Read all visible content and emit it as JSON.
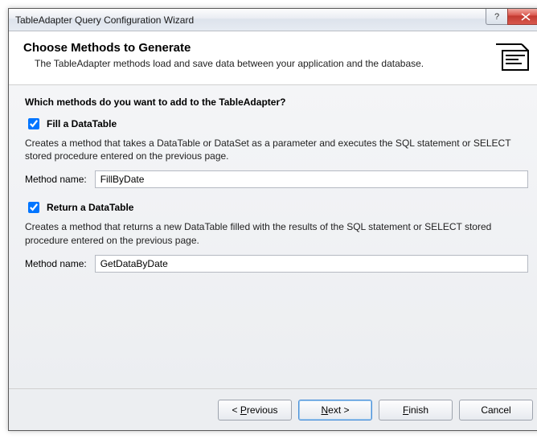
{
  "window": {
    "title": "TableAdapter Query Configuration Wizard"
  },
  "header": {
    "title": "Choose Methods to Generate",
    "subtitle": "The TableAdapter methods load and save data between your application and the database."
  },
  "body": {
    "prompt": "Which methods do you want to add to the TableAdapter?",
    "fill": {
      "checked": true,
      "label": "Fill a DataTable",
      "desc": "Creates a method that takes a DataTable or DataSet as a parameter and executes the SQL statement or SELECT stored procedure entered on the previous page.",
      "method_label": "Method name:",
      "method_value": "FillByDate"
    },
    "ret": {
      "checked": true,
      "label": "Return a DataTable",
      "desc": "Creates a method that returns a new DataTable filled with the results of the SQL statement or SELECT stored procedure entered on the previous page.",
      "method_label": "Method name:",
      "method_value": "GetDataByDate"
    }
  },
  "footer": {
    "previous": "< Previous",
    "next": "Next >",
    "finish": "Finish",
    "cancel": "Cancel"
  }
}
